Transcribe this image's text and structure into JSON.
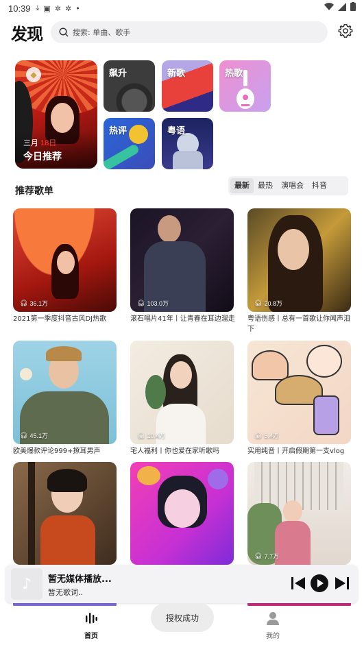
{
  "status_bar": {
    "time": "10:39",
    "icons": [
      "download-icon",
      "photo-icon",
      "bug-icon",
      "bug-icon",
      "dot-icon"
    ]
  },
  "header": {
    "title": "发现",
    "search_placeholder": "搜索: 单曲、歌手"
  },
  "feature": {
    "month": "三月",
    "day": "18日",
    "label": "今日推荐"
  },
  "categories": [
    {
      "label": "飙升",
      "color": "#2e2e3e"
    },
    {
      "label": "新歌",
      "color": "#e8403a"
    },
    {
      "label": "热歌",
      "color": "#d99be8"
    },
    {
      "label": "热评",
      "color": "#2a66d8"
    },
    {
      "label": "粤语",
      "color": "#1f2a6b"
    }
  ],
  "section": {
    "title": "推荐歌单",
    "tabs": [
      "最新",
      "最热",
      "演唱会",
      "抖音"
    ],
    "active_tab": "最新"
  },
  "playlists": [
    {
      "plays": "36.1万",
      "caption": "2021第一季度抖音古风DJ热歌"
    },
    {
      "plays": "103.0万",
      "caption": "滚石唱片41年丨让青春在耳边溜走"
    },
    {
      "plays": "20.8万",
      "caption": "粤语伤感丨总有一首歌让你闻声泪下"
    },
    {
      "plays": "45.1万",
      "caption": "欧美爆款评论999+撩耳男声"
    },
    {
      "plays": "10.4万",
      "caption": "宅人福利丨你也爱在家听歌吗"
    },
    {
      "plays": "5.4万",
      "caption": "实用纯音丨开启假期第一支vlog"
    },
    {
      "plays": "",
      "caption": ""
    },
    {
      "plays": "",
      "caption": ""
    },
    {
      "plays": "7.7万",
      "caption": ""
    }
  ],
  "player": {
    "title": "暂无媒体播放...",
    "lyric": "暂无歌词.."
  },
  "toast": "授权成功",
  "bottom_nav": [
    {
      "label": "首页",
      "icon": "music-bars-icon",
      "active": true
    },
    {
      "label": "我的",
      "icon": "user-icon",
      "active": false
    }
  ],
  "colors": {
    "accent": "#111111",
    "date_highlight": "#ff3b3b"
  }
}
